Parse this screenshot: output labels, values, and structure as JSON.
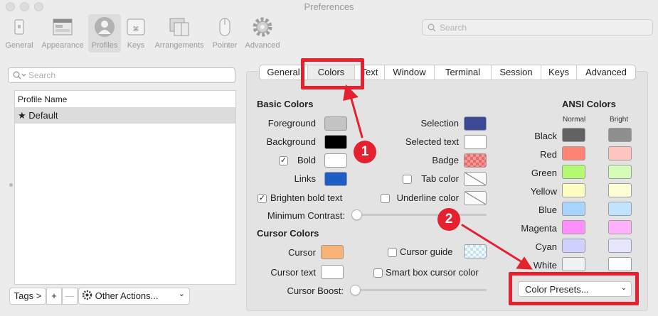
{
  "window": {
    "title": "Preferences"
  },
  "toolbar": {
    "items": [
      {
        "label": "General",
        "icon": "general-icon"
      },
      {
        "label": "Appearance",
        "icon": "appearance-icon"
      },
      {
        "label": "Profiles",
        "icon": "profiles-icon",
        "selected": true
      },
      {
        "label": "Keys",
        "icon": "keys-icon"
      },
      {
        "label": "Arrangements",
        "icon": "arrangements-icon"
      },
      {
        "label": "Pointer",
        "icon": "pointer-icon"
      },
      {
        "label": "Advanced",
        "icon": "gear-icon"
      }
    ],
    "search_placeholder": "Search"
  },
  "profiles": {
    "search_placeholder": "Search",
    "column_header": "Profile Name",
    "rows": [
      {
        "name": "Default",
        "star": "★"
      }
    ],
    "tags_label": "Tags >",
    "add_label": "+",
    "remove_label": "—",
    "other_actions_label": "Other Actions...",
    "other_actions_chevron": "⌄"
  },
  "tabs": [
    "General",
    "Colors",
    "Text",
    "Window",
    "Terminal",
    "Session",
    "Keys",
    "Advanced"
  ],
  "selected_tab": "Colors",
  "basic_colors": {
    "title": "Basic Colors",
    "foreground": {
      "label": "Foreground",
      "color": "#c4c4c4"
    },
    "background": {
      "label": "Background",
      "color": "#000000"
    },
    "bold": {
      "label": "Bold",
      "checked": true,
      "color": "#ffffff"
    },
    "links": {
      "label": "Links",
      "color": "#1e5ec4"
    },
    "brighten_bold": {
      "label": "Brighten bold text",
      "checked": true
    },
    "selection": {
      "label": "Selection",
      "color": "#3c4b97"
    },
    "selected_text": {
      "label": "Selected text",
      "color": "#ffffff"
    },
    "badge": {
      "label": "Badge",
      "color": "#f07878"
    },
    "tab_color": {
      "label": "Tab color",
      "checked": false
    },
    "underline_color": {
      "label": "Underline color",
      "checked": false
    },
    "minimum_contrast": {
      "label": "Minimum Contrast:",
      "value": 0
    }
  },
  "cursor_colors": {
    "title": "Cursor Colors",
    "cursor": {
      "label": "Cursor",
      "color": "#f8b276"
    },
    "cursor_text": {
      "label": "Cursor text",
      "color": "#ffffff"
    },
    "cursor_guide": {
      "label": "Cursor guide",
      "checked": false
    },
    "smart_box": {
      "label": "Smart box cursor color",
      "checked": false
    },
    "cursor_boost": {
      "label": "Cursor Boost:",
      "value": 0
    }
  },
  "ansi": {
    "title": "ANSI Colors",
    "normal_label": "Normal",
    "bright_label": "Bright",
    "rows": [
      {
        "name": "Black",
        "normal": "#626262",
        "bright": "#8e8e8e"
      },
      {
        "name": "Red",
        "normal": "#ff8272",
        "bright": "#ffc4bd"
      },
      {
        "name": "Green",
        "normal": "#b4fa72",
        "bright": "#d6fcb9"
      },
      {
        "name": "Yellow",
        "normal": "#fefdc2",
        "bright": "#fefdd5"
      },
      {
        "name": "Blue",
        "normal": "#a5d5fe",
        "bright": "#c1e3fe"
      },
      {
        "name": "Magenta",
        "normal": "#ff8ffd",
        "bright": "#ffb1fe"
      },
      {
        "name": "Cyan",
        "normal": "#d0d1fe",
        "bright": "#e5e6fe"
      },
      {
        "name": "White",
        "normal": "#f1f1f1",
        "bright": "#feffff"
      }
    ]
  },
  "color_presets": {
    "label": "Color Presets...",
    "chevron": "⌄"
  },
  "annotations": {
    "marker1": "1",
    "marker2": "2",
    "accent": "#e5202f"
  }
}
